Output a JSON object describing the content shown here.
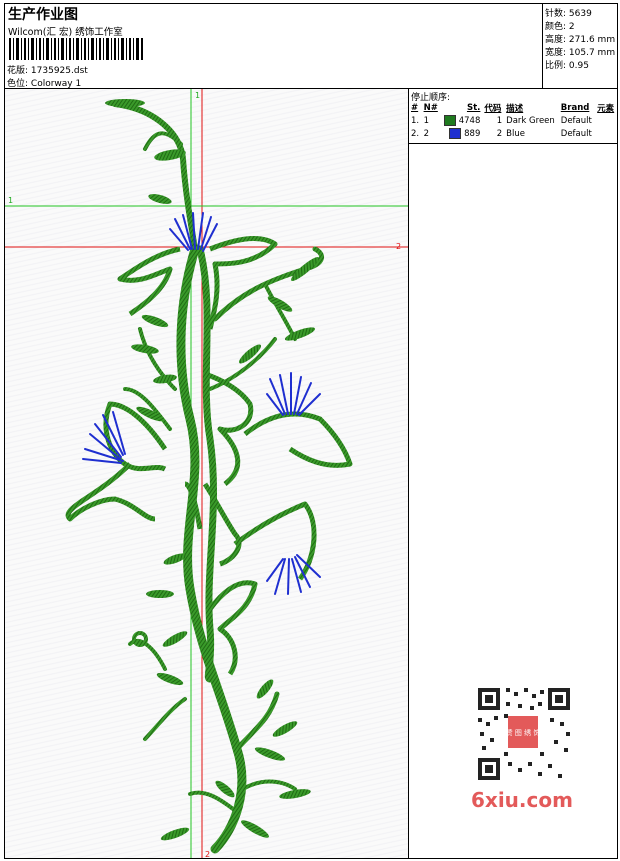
{
  "header": {
    "title": "生产作业图",
    "subtitle": "Wilcom(汇 宏) 绣饰工作室",
    "file_label": "花版:",
    "file_value": "1735925.dst",
    "color_label": "色位:",
    "color_value": "Colorway 1"
  },
  "stats": [
    {
      "label": "针数:",
      "value": "5639"
    },
    {
      "label": "颜色:",
      "value": "2"
    },
    {
      "label": "高度:",
      "value": "271.6 mm"
    },
    {
      "label": "宽度:",
      "value": "105.7 mm"
    },
    {
      "label": "比例:",
      "value": "0.95"
    }
  ],
  "sequence": {
    "title": "停止顺序:",
    "columns": [
      "#",
      "N#",
      "St.",
      "代码",
      "描述",
      "Brand",
      "元素"
    ],
    "rows": [
      {
        "idx": "1.",
        "n": "1",
        "st": "4748",
        "code": "1",
        "desc": "Dark Green",
        "brand": "Default",
        "color": "#1f7a1f"
      },
      {
        "idx": "2.",
        "n": "2",
        "st": "889",
        "code": "2",
        "desc": "Blue",
        "brand": "Default",
        "color": "#1f2fd0"
      }
    ]
  },
  "guides": {
    "green_vertical": "1",
    "green_horizontal": "1",
    "red_vertical": "2",
    "red_horizontal": "2"
  },
  "colors": {
    "thread_green": "#2a8a1e",
    "thread_blue": "#1f2fd0",
    "guide_green": "#22c422",
    "guide_red": "#e01010"
  },
  "watermark": {
    "brand": "6xiu.com",
    "stamp": "赞 图 绣 饰"
  }
}
